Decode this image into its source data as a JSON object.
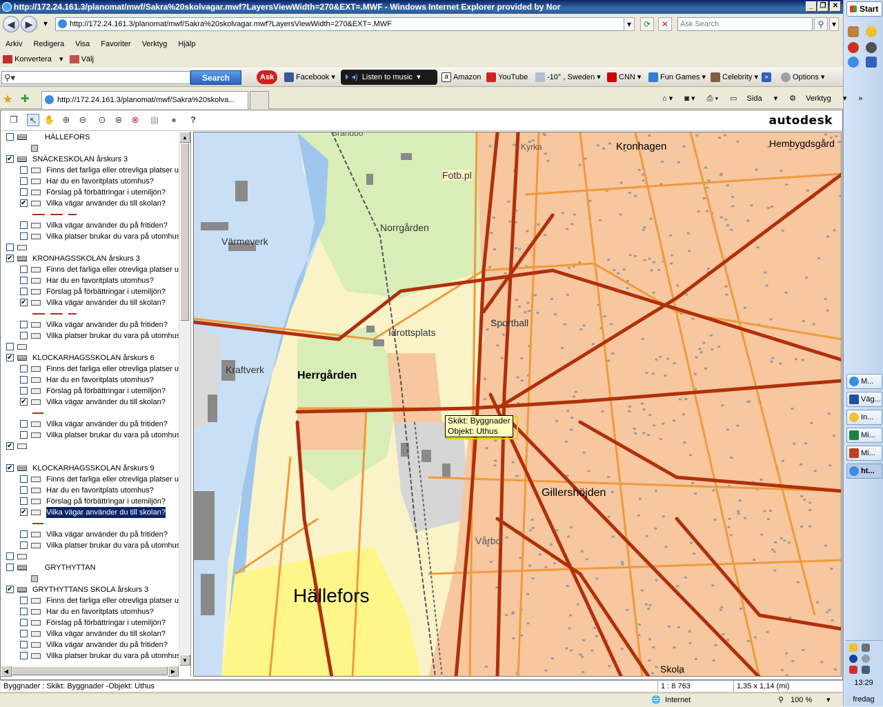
{
  "window": {
    "title": "http://172.24.161.3/planomat/mwf/Sakra%20skolvagar.mwf?LayersViewWidth=270&EXT=.MWF - Windows Internet Explorer provided by Nor"
  },
  "address": {
    "url": "http://172.24.161.3/planomat/mwf/Sakra%20skolvagar.mwf?LayersViewWidth=270&EXT=.MWF",
    "search_placeholder": "Ask Search"
  },
  "menu": [
    "Arkiv",
    "Redigera",
    "Visa",
    "Favoriter",
    "Verktyg",
    "Hjälp"
  ],
  "command": {
    "convert": "Konvertera",
    "select": "Välj"
  },
  "toolbar": {
    "search_button": "Search",
    "facebook": "Facebook",
    "listen": "Listen to music",
    "amazon": "Amazon",
    "youtube": "YouTube",
    "weather": "-10° , Sweden",
    "cnn": "CNN",
    "fungames": "Fun Games",
    "celebrity": "Celebrity",
    "options": "Options"
  },
  "tab": {
    "label": "http://172.24.161.3/planomat/mwf/Sakra%20skolva..."
  },
  "cmdbar": {
    "page": "Sida",
    "tools": "Verktyg"
  },
  "viewer": {
    "brand": "autodesk"
  },
  "layers": [
    {
      "indent": 0,
      "check": false,
      "group": true,
      "label": "HÄLLEFORS",
      "labelx": 64
    },
    {
      "indent": 1,
      "check": null,
      "gray": true,
      "label": ""
    },
    {
      "indent": 0,
      "check": true,
      "group": true,
      "label": "SNÄCKESKOLAN årskurs 3"
    },
    {
      "indent": 1,
      "check": false,
      "label": "Finns det farliga eller otrevliga platser uto"
    },
    {
      "indent": 1,
      "check": false,
      "label": "Har du en favoritplats utomhus?"
    },
    {
      "indent": 1,
      "check": false,
      "label": "Förslag på förbättringar i utemiljön?"
    },
    {
      "indent": 1,
      "check": true,
      "label": "Vilka vägar använder du till skolan?"
    },
    {
      "indent": 2,
      "legend": "dashes",
      "label": ""
    },
    {
      "indent": 1,
      "check": false,
      "label": "Vilka vägar använder du på fritiden?"
    },
    {
      "indent": 1,
      "check": false,
      "label": "Vilka platser brukar du vara på utomhus?"
    },
    {
      "indent": 0,
      "check": false,
      "label": ""
    },
    {
      "indent": 0,
      "check": true,
      "group": true,
      "label": "KRONHAGSSKOLAN årskurs 3"
    },
    {
      "indent": 1,
      "check": false,
      "label": "Finns det farliga eller otrevliga platser uto"
    },
    {
      "indent": 1,
      "check": false,
      "label": "Har du en favoritplats utomhus?"
    },
    {
      "indent": 1,
      "check": false,
      "label": "Förslag på förbättringar i utemiljön?"
    },
    {
      "indent": 1,
      "check": true,
      "label": "Vilka vägar använder du till skolan?"
    },
    {
      "indent": 2,
      "legend": "dashes",
      "label": ""
    },
    {
      "indent": 1,
      "check": false,
      "label": "Vilka vägar använder du på fritiden?"
    },
    {
      "indent": 1,
      "check": false,
      "label": "Vilka platser brukar du vara på utomhus?"
    },
    {
      "indent": 0,
      "check": false,
      "label": ""
    },
    {
      "indent": 0,
      "check": true,
      "group": true,
      "label": "KLOCKARHAGSSKOLAN årskurs 6"
    },
    {
      "indent": 1,
      "check": false,
      "label": "Finns det farliga eller otrevliga platser uto"
    },
    {
      "indent": 1,
      "check": false,
      "label": "Har du en favoritplats utomhus?"
    },
    {
      "indent": 1,
      "check": false,
      "label": "Förslag på förbättringar i utemiljön?"
    },
    {
      "indent": 1,
      "check": true,
      "label": "Vilka vägar använder du till skolan?"
    },
    {
      "indent": 2,
      "legend": "line",
      "label": ""
    },
    {
      "indent": 1,
      "check": false,
      "label": "Vilka vägar använder du på fritiden?"
    },
    {
      "indent": 1,
      "check": false,
      "label": "Vilka platser brukar du vara på utomhus?"
    },
    {
      "indent": 0,
      "check": true,
      "label": ""
    },
    {
      "indent": 0,
      "spacer": true,
      "label": ""
    },
    {
      "indent": 0,
      "check": true,
      "group": true,
      "label": "KLOCKARHAGSSKOLAN årskurs 9"
    },
    {
      "indent": 1,
      "check": false,
      "label": "Finns det farliga eller otrevliga platser uto"
    },
    {
      "indent": 1,
      "check": false,
      "label": "Har du en favoritplats utomhus?"
    },
    {
      "indent": 1,
      "check": false,
      "label": "Förslag på förbättringar i utemiljön?"
    },
    {
      "indent": 1,
      "check": true,
      "selected": true,
      "label": "Vilka vägar använder du till skolan?"
    },
    {
      "indent": 2,
      "legend": "line",
      "label": ""
    },
    {
      "indent": 1,
      "check": false,
      "label": "Vilka vägar använder du på fritiden?"
    },
    {
      "indent": 1,
      "check": false,
      "label": "Vilka platser brukar du vara på utomhus?"
    },
    {
      "indent": 0,
      "check": false,
      "label": ""
    },
    {
      "indent": 0,
      "check": false,
      "group": true,
      "label": "GRYTHYTTAN",
      "labelx": 64
    },
    {
      "indent": 1,
      "check": null,
      "gray": true,
      "label": ""
    },
    {
      "indent": 0,
      "check": true,
      "group": true,
      "label": "GRYTHYTTANS SKOLA årskurs 3"
    },
    {
      "indent": 1,
      "check": false,
      "label": "Finns det farliga eller otrevliga platser uto"
    },
    {
      "indent": 1,
      "check": false,
      "label": "Har du en favoritplats utomhus?"
    },
    {
      "indent": 1,
      "check": false,
      "label": "Förslag på förbättringar i utemiljön?"
    },
    {
      "indent": 1,
      "check": false,
      "label": "Vilka vägar använder du till skolan?"
    },
    {
      "indent": 1,
      "check": false,
      "label": "Vilka vägar använder du på fritiden?"
    },
    {
      "indent": 1,
      "check": false,
      "label": "Vilka platser brukar du vara på utomhus?"
    }
  ],
  "map": {
    "labels": {
      "kronhagen": "Kronhagen",
      "hembygdsgard": "Hembygdsgård",
      "fotb": "Fotb.pl",
      "norrgarden": "Norrgården",
      "varmeverk": "Värmeverk",
      "idrottsplats": "Idrottsplats",
      "sporthall": "Sporthall",
      "kraftverk": "Kraftverk",
      "herrgarden": "Herrgården",
      "gillershojden": "Gillershöjden",
      "varbo": "Vårbo",
      "hallefors": "Hällefors",
      "skola": "Skola",
      "brandbo": "Brandbo",
      "kyrka": "Kyrka"
    },
    "tooltip": {
      "line1": "Skikt: Byggnader",
      "line2": "Objekt: Uthus"
    }
  },
  "viewer_status": {
    "text": "Byggnader : Skikt: Byggnader -Objekt: Uthus",
    "scale": "1 : 8 763",
    "coords": "1,35 x 1,14 (mi)"
  },
  "ie_status": {
    "zone": "Internet",
    "zoom": "100 %"
  },
  "taskbar": {
    "start": "Start",
    "tasks": [
      "M...",
      "Väg...",
      "In...",
      "Mi...",
      "Mi...",
      "ht..."
    ],
    "clock": "13:29",
    "day": "fredag"
  }
}
